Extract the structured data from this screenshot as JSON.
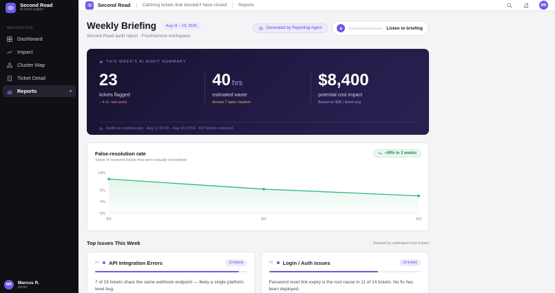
{
  "sidebar": {
    "app_name": "Second Read",
    "app_subtitle": "AI ticket auditor",
    "nav_heading": "NAVIGATION",
    "items": [
      {
        "label": "Dashboard",
        "icon": "grid-icon",
        "active": false
      },
      {
        "label": "Impact",
        "icon": "trend-icon",
        "active": false
      },
      {
        "label": "Cluster Map",
        "icon": "cluster-icon",
        "active": false
      },
      {
        "label": "Ticket Detail",
        "icon": "document-icon",
        "active": false
      },
      {
        "label": "Reports",
        "icon": "bar-chart-icon",
        "active": true
      }
    ],
    "user": {
      "initials": "MR",
      "name": "Marcus R.",
      "role": "Admin"
    }
  },
  "topbar": {
    "app_name": "Second Read",
    "tagline": "Catching tickets that shouldn't have closed",
    "link": "Reports",
    "avatar_initials": "MR"
  },
  "header": {
    "title": "Weekly Briefing",
    "date_range": "Aug 11 – 18, 2026",
    "subtitle": "Second Read audit report · Freshservice workspace",
    "generated_label": "Generated by Reporting Agent",
    "listen_label": "Listen to briefing"
  },
  "summary": {
    "heading": "THIS WEEK'S AI AUDIT SUMMARY",
    "stats": [
      {
        "value": "23",
        "unit": "",
        "label": "tickets flagged",
        "note": "↑ 4 vs. last week"
      },
      {
        "value": "40",
        "unit": "hrs",
        "label": "estimated waste",
        "note": "Across 7 open clusters"
      },
      {
        "value": "$8,400",
        "unit": "",
        "label": "potential cost impact",
        "note": "Based on $35 / ticket avg"
      }
    ],
    "footer": "Audit ran continuously · Aug 11 00:00 – Aug 18 23:59 · 847 tickets reviewed"
  },
  "chart": {
    "title": "False-resolution rate",
    "subtitle": "Share of resolved tickets that were actually unresolved",
    "badge": "−49% in 3 weeks"
  },
  "chart_data": {
    "type": "area",
    "categories": [
      "W1",
      "W2",
      "W3"
    ],
    "values": [
      11.8,
      8.3,
      6.0
    ],
    "yticks": [
      "0%",
      "4%",
      "8%",
      "14%"
    ],
    "ytick_values": [
      0,
      4,
      8,
      14
    ],
    "ylim": [
      0,
      14
    ],
    "line_color": "#2fb877",
    "grid": false
  },
  "issues": {
    "title": "Top Issues This Week",
    "meta": "Ranked by estimated cost impact",
    "cards": [
      {
        "rank": "#1",
        "name": "API Integration Errors",
        "count": "19 tickets",
        "dot_color": "#6c5ce7",
        "fill": 0.95,
        "bar_color": "#6c5ce7",
        "desc": "7 of 19 tickets share the same webhook endpoint — likely a single platform-level bug."
      },
      {
        "rank": "#2",
        "name": "Login / Auth Issues",
        "count": "14 tickets",
        "dot_color": "#5b5fd6",
        "fill": 0.72,
        "bar_color": "#5b5fd6",
        "desc": "Password reset link expiry is the root cause in 11 of 14 tickets. No fix has been deployed."
      }
    ]
  }
}
